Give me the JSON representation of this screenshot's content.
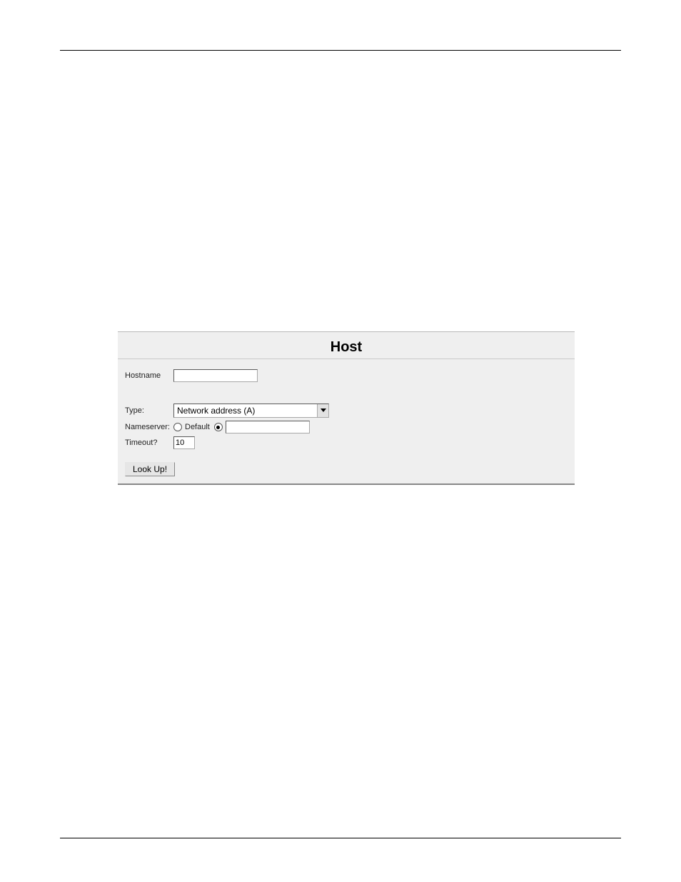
{
  "panel": {
    "title": "Host",
    "hostname_label": "Hostname",
    "hostname_value": "",
    "type_label": "Type:",
    "type_selected": "Network address (A)",
    "nameserver_label": "Nameserver:",
    "ns_default_label": "Default",
    "ns_custom_value": "",
    "timeout_label": "Timeout?",
    "timeout_value": "10",
    "submit_label": "Look Up!"
  }
}
